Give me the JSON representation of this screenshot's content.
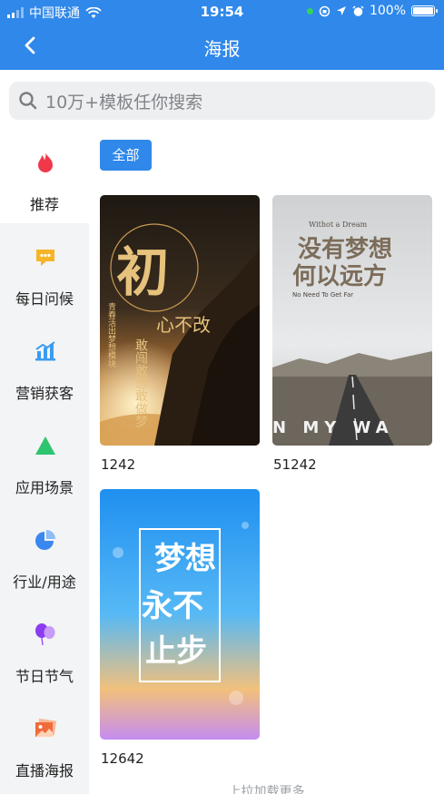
{
  "status_bar": {
    "carrier": "中国联通",
    "time": "19:54",
    "battery": "100%"
  },
  "nav": {
    "title": "海报"
  },
  "search": {
    "placeholder": "10万+模板任你搜索"
  },
  "sidebar": {
    "items": [
      {
        "label": "推荐",
        "icon": "flame-icon",
        "active": true
      },
      {
        "label": "每日问候",
        "icon": "chat-icon",
        "active": false
      },
      {
        "label": "营销获客",
        "icon": "bar-chart-icon",
        "active": false
      },
      {
        "label": "应用场景",
        "icon": "triangle-icon",
        "active": false
      },
      {
        "label": "行业/用途",
        "icon": "pie-chart-icon",
        "active": false
      },
      {
        "label": "节日节气",
        "icon": "balloon-icon",
        "active": false
      },
      {
        "label": "直播海报",
        "icon": "image-icon",
        "active": false
      }
    ]
  },
  "filter": {
    "all_label": "全部"
  },
  "posters": [
    {
      "title": "初心不改",
      "side_text": "青春活出梦想模块",
      "slogan": "敢闯敢想敢做梦",
      "count": "1242"
    },
    {
      "title": "没有梦想何以远方",
      "en_top": "Withot a Dream",
      "en_bottom": "No Need To Get Far",
      "road_text": "N MY WA",
      "count": "51242"
    },
    {
      "title": "梦想永不止步",
      "count": "12642"
    }
  ],
  "footer": {
    "load_more": "上拉加载更多"
  },
  "colors": {
    "primary": "#2f88ea",
    "sidebar_bg": "#f3f4f6",
    "search_bg": "#eeeff1"
  }
}
